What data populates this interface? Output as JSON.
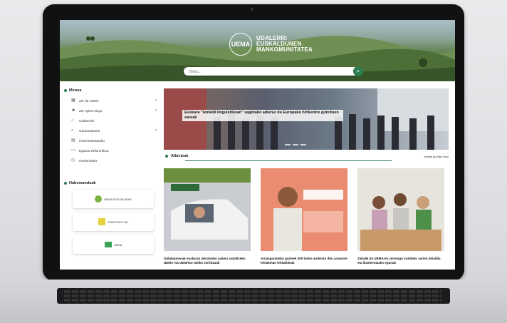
{
  "header": {
    "logo_mark": "UEMA",
    "logo_line1": "UDALERRI",
    "logo_line2": "EUSKALDUNEN",
    "logo_line3": "MANKOMUNITATEA",
    "search_placeholder": "Bilatu..."
  },
  "sidebar": {
    "menu_title": "Menua",
    "items": [
      {
        "label": "Zer da UEMA",
        "icon": "building-icon",
        "has_submenu": true
      },
      {
        "label": "Zer egiten dugu",
        "icon": "people-icon",
        "has_submenu": true
      },
      {
        "label": "Udalerriak",
        "icon": "house-icon",
        "has_submenu": false
      },
      {
        "label": "Gardentasuna",
        "icon": "magnifier-icon",
        "has_submenu": true
      },
      {
        "label": "Harremanetarako",
        "icon": "document-icon",
        "has_submenu": false
      },
      {
        "label": "Egoitza elektronikoa",
        "icon": "monitor-icon",
        "has_submenu": false
      },
      {
        "label": "Hemeroteka",
        "icon": "clock-icon",
        "has_submenu": false
      }
    ],
    "partners_title": "Habemanduak",
    "partners": [
      "UEMA ESKUALDEAK",
      "SORI PAPO RA",
      "UEMA"
    ]
  },
  "slider": {
    "caption": "Euskara \"lemaldi linguistikoan\" sagotako adieraz du Europako hirikentre gutxituen sareak"
  },
  "news": {
    "title": "Albisteak",
    "more_link": "Albiste guztiak ikusi",
    "cards": [
      {
        "caption": "Gidabaimenak euskaraz ateratzeko aukera zabaltzeko UEMA eta UEMAko tokiko zerbitzuak"
      },
      {
        "caption": "Arnasgunetako gazteek 300 bideo aurkeztu ditu arnasote lehiaketan lehiakideak"
      },
      {
        "caption": "Zabalik da UEMAren zerrengo iruditeko sarien deialdia eta ikasleentzako egunak"
      }
    ]
  },
  "colors": {
    "accent": "#2e7d4f"
  }
}
